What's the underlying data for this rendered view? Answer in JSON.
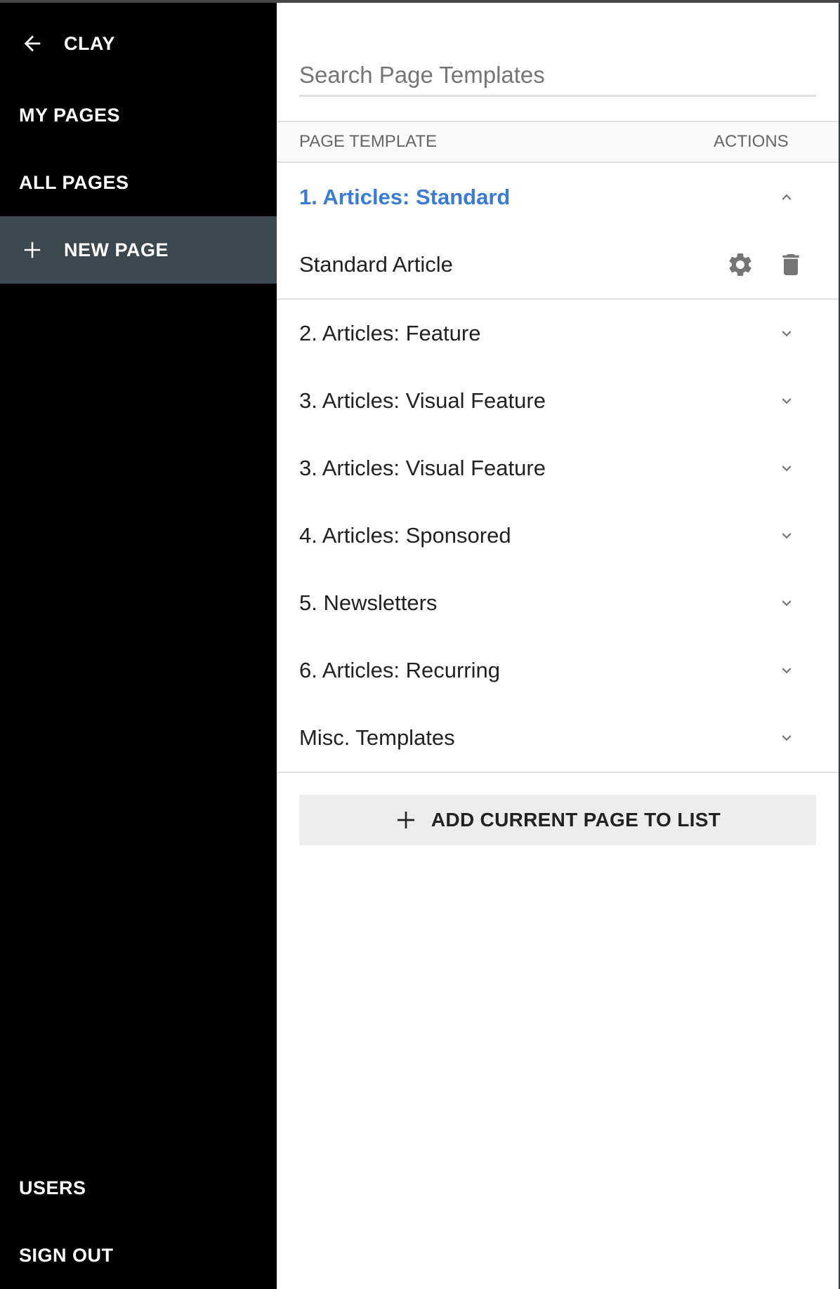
{
  "sidebar": {
    "back": {
      "label": "CLAY",
      "icon": "arrow-left-icon"
    },
    "top_items": [
      {
        "label": "MY PAGES"
      },
      {
        "label": "ALL PAGES"
      },
      {
        "label": "NEW PAGE",
        "icon": "plus-icon",
        "active": true
      }
    ],
    "bottom_items": [
      {
        "label": "USERS"
      },
      {
        "label": "SIGN OUT"
      }
    ]
  },
  "main": {
    "search": {
      "placeholder": "Search Page Templates",
      "value": ""
    },
    "table_header": {
      "template": "PAGE TEMPLATE",
      "actions": "ACTIONS"
    },
    "groups": [
      {
        "label": "1. Articles: Standard",
        "expanded": true,
        "icon": "chevron-up-icon",
        "items": [
          {
            "label": "Standard Article",
            "actions": [
              "gear-icon",
              "trash-icon"
            ]
          }
        ]
      },
      {
        "label": "2. Articles: Feature",
        "expanded": false,
        "icon": "chevron-down-icon"
      },
      {
        "label": "3. Articles: Visual Feature",
        "expanded": false,
        "icon": "chevron-down-icon"
      },
      {
        "label": "3. Articles: Visual Feature",
        "expanded": false,
        "icon": "chevron-down-icon"
      },
      {
        "label": "4. Articles: Sponsored",
        "expanded": false,
        "icon": "chevron-down-icon"
      },
      {
        "label": "5. Newsletters",
        "expanded": false,
        "icon": "chevron-down-icon"
      },
      {
        "label": "6. Articles: Recurring",
        "expanded": false,
        "icon": "chevron-down-icon"
      },
      {
        "label": "Misc. Templates",
        "expanded": false,
        "icon": "chevron-down-icon"
      }
    ],
    "add_button": {
      "label": "ADD CURRENT PAGE TO LIST",
      "icon": "plus-icon"
    }
  },
  "colors": {
    "active_group": "#3a7bd5",
    "sidebar_bg": "#000000",
    "sidebar_active": "#3c4850",
    "icon_gray": "#757575"
  }
}
